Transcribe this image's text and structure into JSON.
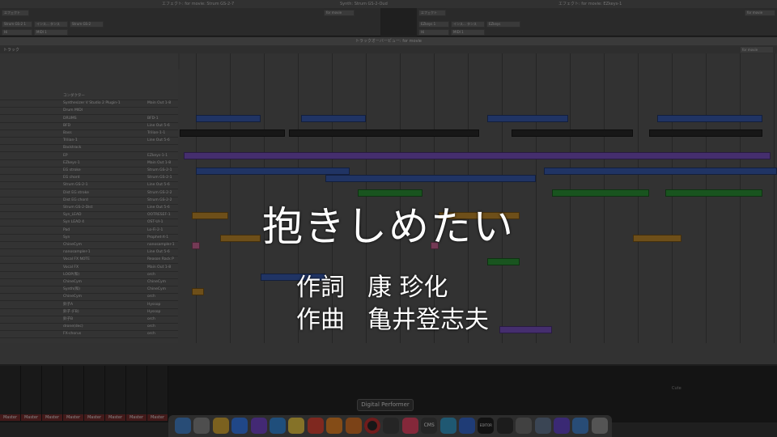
{
  "menubar": {
    "left_title": "エフェクト: for movie: Strum GS-2-7",
    "mid_title": "Synth: Strum GS-2-Oud",
    "right_title": "エフェクト: for movie: EZkeys-1"
  },
  "top_windows": {
    "left": {
      "label": "エフェクト",
      "fields": [
        "Strum GS-2 1",
        "インス... タンス",
        "Strum GS-2",
        "Hi",
        "MIDI 1"
      ],
      "preset": "for movie"
    },
    "right": {
      "label": "エフェクト",
      "fields": [
        "EZkeys 1",
        "インス... タンス",
        "EZkeys",
        "Hi",
        "MIDI 1"
      ],
      "preset": "for movie"
    }
  },
  "main_window": {
    "title": "トラックオーバービュー: for movie",
    "tab_label": "トラック",
    "search_placeholder": "",
    "view_selector": "for movie",
    "toolbar_selects": [
      "for movie",
      "mini"
    ],
    "transport": {
      "counter_1": "TIMING",
      "counter_2": "SECTION",
      "counter_3": "MARKER"
    },
    "right_preset": "for movie"
  },
  "tracks": [
    {
      "name": "コンダクター",
      "output": ""
    },
    {
      "name": "Synthesizer V Studio 2 Plugin-1",
      "output": "Main Out 1-8"
    },
    {
      "name": "Drum MIDI",
      "output": ""
    },
    {
      "name": "DRUMS",
      "output": "BFD-1"
    },
    {
      "name": "BFD",
      "output": "Line Out 5-6"
    },
    {
      "name": "Bass",
      "output": "Trilian-1-1"
    },
    {
      "name": "Trilian-1",
      "output": "Line Out 5-6"
    },
    {
      "name": "Backtrack",
      "output": ""
    },
    {
      "name": "EP",
      "output": "EZkeys-1-1"
    },
    {
      "name": "EZkeys-1",
      "output": "Main Out 1-8"
    },
    {
      "name": "EG stroke",
      "output": "Strum GS-2-1"
    },
    {
      "name": "EG chord",
      "output": "Strum GS-2-1"
    },
    {
      "name": "Strum GS-2-1",
      "output": "Line Out 5-6"
    },
    {
      "name": "Dist EG stroke",
      "output": "Strum GS-2-2"
    },
    {
      "name": "Dist EG chord",
      "output": "Strum GS-2-2"
    },
    {
      "name": "Strum GS-2-Dist",
      "output": "Line Out 5-6"
    },
    {
      "name": "Syn_LEAD",
      "output": "OOTRESEF-1"
    },
    {
      "name": "Syn LEAD 4",
      "output": "OST-UI-1"
    },
    {
      "name": "Pad",
      "output": "Lo-Fi-2-1"
    },
    {
      "name": "Syn",
      "output": "Prophet-X-1"
    },
    {
      "name": "ChineCym",
      "output": "nanosampler-1"
    },
    {
      "name": "nanosampler-1",
      "output": "Line Out 5-6"
    },
    {
      "name": "Vocal FX NOTE",
      "output": "Reason Rack P"
    },
    {
      "name": "Vocal FX",
      "output": "Main Out 1-8"
    },
    {
      "name": "LOOP(和)",
      "output": "orch"
    },
    {
      "name": "ChineCym",
      "output": "ChineCym"
    },
    {
      "name": "Synth(和)",
      "output": "ChineCym"
    },
    {
      "name": "ChineCym",
      "output": "orch"
    },
    {
      "name": "鈴子A",
      "output": "Hyssop"
    },
    {
      "name": "鈴子 (FB)",
      "output": "Hyssop"
    },
    {
      "name": "鈴子B",
      "output": "orch"
    },
    {
      "name": "drone(dec)",
      "output": "orch"
    },
    {
      "name": "FX-chorus",
      "output": "orch"
    }
  ],
  "mixer": {
    "channel_label": "Master",
    "right_label": "Cute"
  },
  "dock": {
    "tooltip": "Digital Performer",
    "icons": [
      "finder-icon",
      "launchpad-icon",
      "chrome-icon",
      "safari-icon",
      "podcast-icon",
      "mail-icon",
      "notes-icon",
      "reminders-icon",
      "photos-icon",
      "vlc-icon",
      "dp-icon",
      "logic-icon",
      "music-icon",
      "cms-icon",
      "app-icon",
      "browser-icon",
      "editor-icon",
      "piano-icon",
      "settings-icon",
      "preview-icon",
      "bracket-icon",
      "finder2-icon",
      "trash-icon"
    ],
    "cms_label": "CMS",
    "editor_label": "EDITOR"
  },
  "lyrics": {
    "title": "抱きしめたい",
    "lyricist_role": "作詞",
    "lyricist": "康 珍化",
    "composer_role": "作曲",
    "composer": "亀井登志夫"
  },
  "colors": {
    "blue_clip": "#3b5fb6",
    "purple_clip": "#7e54c8",
    "green_clip": "#2f9a3a",
    "orange_clip": "#c9902e",
    "pink_clip": "#d46b9c",
    "dark_clip": "#2a2a2a"
  }
}
